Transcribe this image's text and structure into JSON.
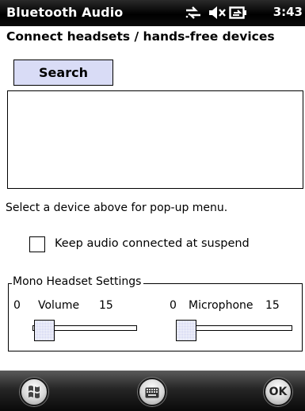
{
  "titlebar": {
    "title": "Bluetooth Audio",
    "time": "3:43",
    "icons": [
      "connectivity-arrows-icon",
      "speaker-muted-icon",
      "battery-charging-icon"
    ]
  },
  "heading": "Connect headsets / hands-free devices",
  "search_button": {
    "label": "Search"
  },
  "device_list": {
    "items": []
  },
  "hint": "Select a device above for pop-up menu.",
  "keep_audio": {
    "label": "Keep audio connected at suspend",
    "checked": false
  },
  "mono_headset": {
    "group_label": "Mono Headset Settings",
    "volume": {
      "min_label": "0",
      "label": "Volume",
      "max_label": "15",
      "value": 0
    },
    "microphone": {
      "min_label": "0",
      "label": "Microphone",
      "max_label": "15",
      "value": 0
    }
  },
  "bottombar": {
    "start_icon": "windows-start-icon",
    "keyboard_icon": "keyboard-icon",
    "ok_label": "OK"
  },
  "colors": {
    "button_fill": "#d9dcf6",
    "slider_thumb": "#cdd1f0",
    "titlebar": "#000000"
  }
}
